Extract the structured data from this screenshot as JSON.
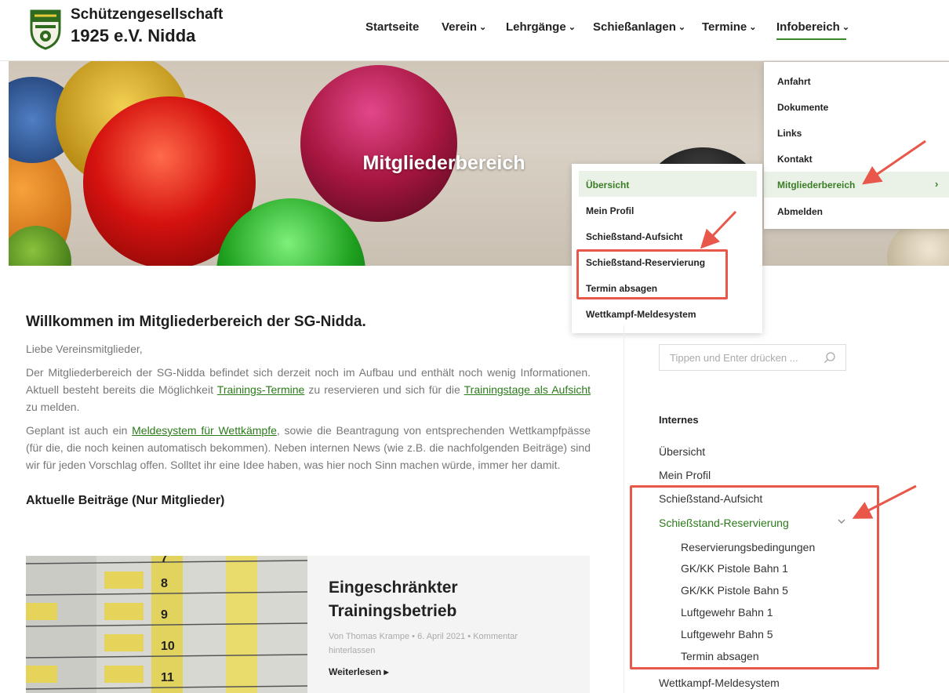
{
  "header": {
    "brand_line1": "Schützengesellschaft",
    "brand_line2": "1925 e.V. Nidda",
    "logo_icon": "shield-logo-icon"
  },
  "nav": {
    "items": [
      {
        "label": "Startseite",
        "has_dropdown": false
      },
      {
        "label": "Verein",
        "has_dropdown": true
      },
      {
        "label": "Lehrgänge",
        "has_dropdown": true
      },
      {
        "label": "Schießanlagen",
        "has_dropdown": true
      },
      {
        "label": "Termine",
        "has_dropdown": true
      },
      {
        "label": "Infobereich",
        "has_dropdown": true,
        "active": true
      }
    ],
    "chevron": "⌄"
  },
  "hero": {
    "title": "Mitgliederbereich"
  },
  "info_dropdown": {
    "items": [
      "Anfahrt",
      "Dokumente",
      "Links",
      "Kontakt",
      "Mitgliederbereich",
      "Abmelden"
    ],
    "active_item": "Mitgliederbereich",
    "chevron": "›"
  },
  "member_dropdown": {
    "items": [
      "Übersicht",
      "Mein Profil",
      "Schießstand-Aufsicht",
      "Schießstand-Reservierung",
      "Termin absagen",
      "Wettkampf-Meldesystem"
    ],
    "active_item": "Übersicht"
  },
  "main": {
    "heading": "Willkommen im Mitgliederbereich der SG-Nidda.",
    "greeting": "Liebe Vereinsmitglieder,",
    "para1_a": "Der Mitgliederbereich der SG-Nidda befindet sich derzeit noch im Aufbau und enthält noch wenig Informationen. Aktuell besteht bereits die Möglichkeit ",
    "para1_link1": "Trainings-Termine",
    "para1_b": " zu reservieren und sich für die ",
    "para1_link2": "Trainingstage als Aufsicht",
    "para1_c": " zu melden.",
    "para2_a": "Geplant ist auch ein ",
    "para2_link": "Meldesystem für Wettkämpfe",
    "para2_b": ", sowie die Beantragung von entsprechenden Wettkampfpässe (für die, die noch keinen automatisch bekommen). Neben internen News (wie z.B. die nachfolgenden Beiträge) sind wir für jeden Vorschlag offen. Solltet ihr eine Idee haben, was hier noch Sinn machen würde, immer her damit.",
    "posts_heading": "Aktuelle Beiträge (Nur Mitglieder)"
  },
  "post": {
    "title": "Eingeschränkter Trainingsbetrieb",
    "meta": "Von Thomas Krampe • 6. April 2021 • Kommentar hinterlassen",
    "read_more": "Weiterlesen ▸"
  },
  "sidebar": {
    "search_placeholder": "Tippen und Enter drücken ...",
    "heading": "Internes",
    "items": [
      "Übersicht",
      "Mein Profil",
      "Schießstand-Aufsicht",
      "Schießstand-Reservierung"
    ],
    "subitems": [
      "Reservierungsbedingungen",
      "GK/KK Pistole Bahn 1",
      "GK/KK Pistole Bahn 5",
      "Luftgewehr Bahn 1",
      "Luftgewehr Bahn 5",
      "Termin absagen"
    ],
    "last_item": "Wettkampf-Meldesystem",
    "active_item": "Schießstand-Reservierung"
  },
  "colors": {
    "accent_green": "#3a7d25",
    "highlight_red": "#e8574a",
    "active_bg": "#eaf2e8"
  }
}
